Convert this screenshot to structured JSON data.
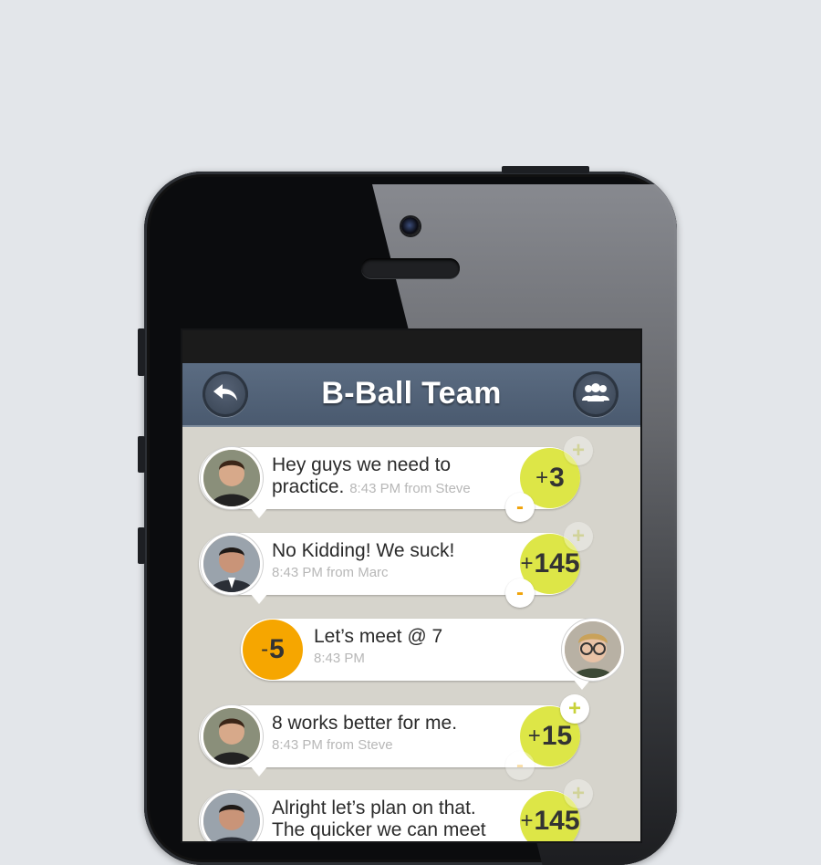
{
  "header": {
    "title": "B-Ball Team"
  },
  "icons": {
    "back": "back-arrow-icon",
    "group": "group-icon"
  },
  "colors": {
    "score_green": "#dde647",
    "score_orange": "#f6a600",
    "navbar": "#4f6075"
  },
  "messages": [
    {
      "text_line1": "Hey guys we need to",
      "text_line2": "practice.",
      "meta": "8:43 PM from Steve",
      "score_sign": "+",
      "score": "3"
    },
    {
      "text_line1": "No Kidding! We suck!",
      "meta": "8:43 PM from Marc",
      "score_sign": "+",
      "score": "145"
    },
    {
      "text_line1": "Let’s meet @ 7",
      "meta": "8:43 PM",
      "score_sign": "-",
      "score": "5"
    },
    {
      "text_line1": "8 works better for me.",
      "meta": "8:43 PM from Steve",
      "score_sign": "+",
      "score": "15"
    },
    {
      "text_line1": "Alright let’s plan on that.",
      "text_line2": "The quicker we can meet",
      "score_sign": "+",
      "score": "145"
    }
  ],
  "vote_controls": {
    "plus": "+",
    "minus": "-"
  }
}
